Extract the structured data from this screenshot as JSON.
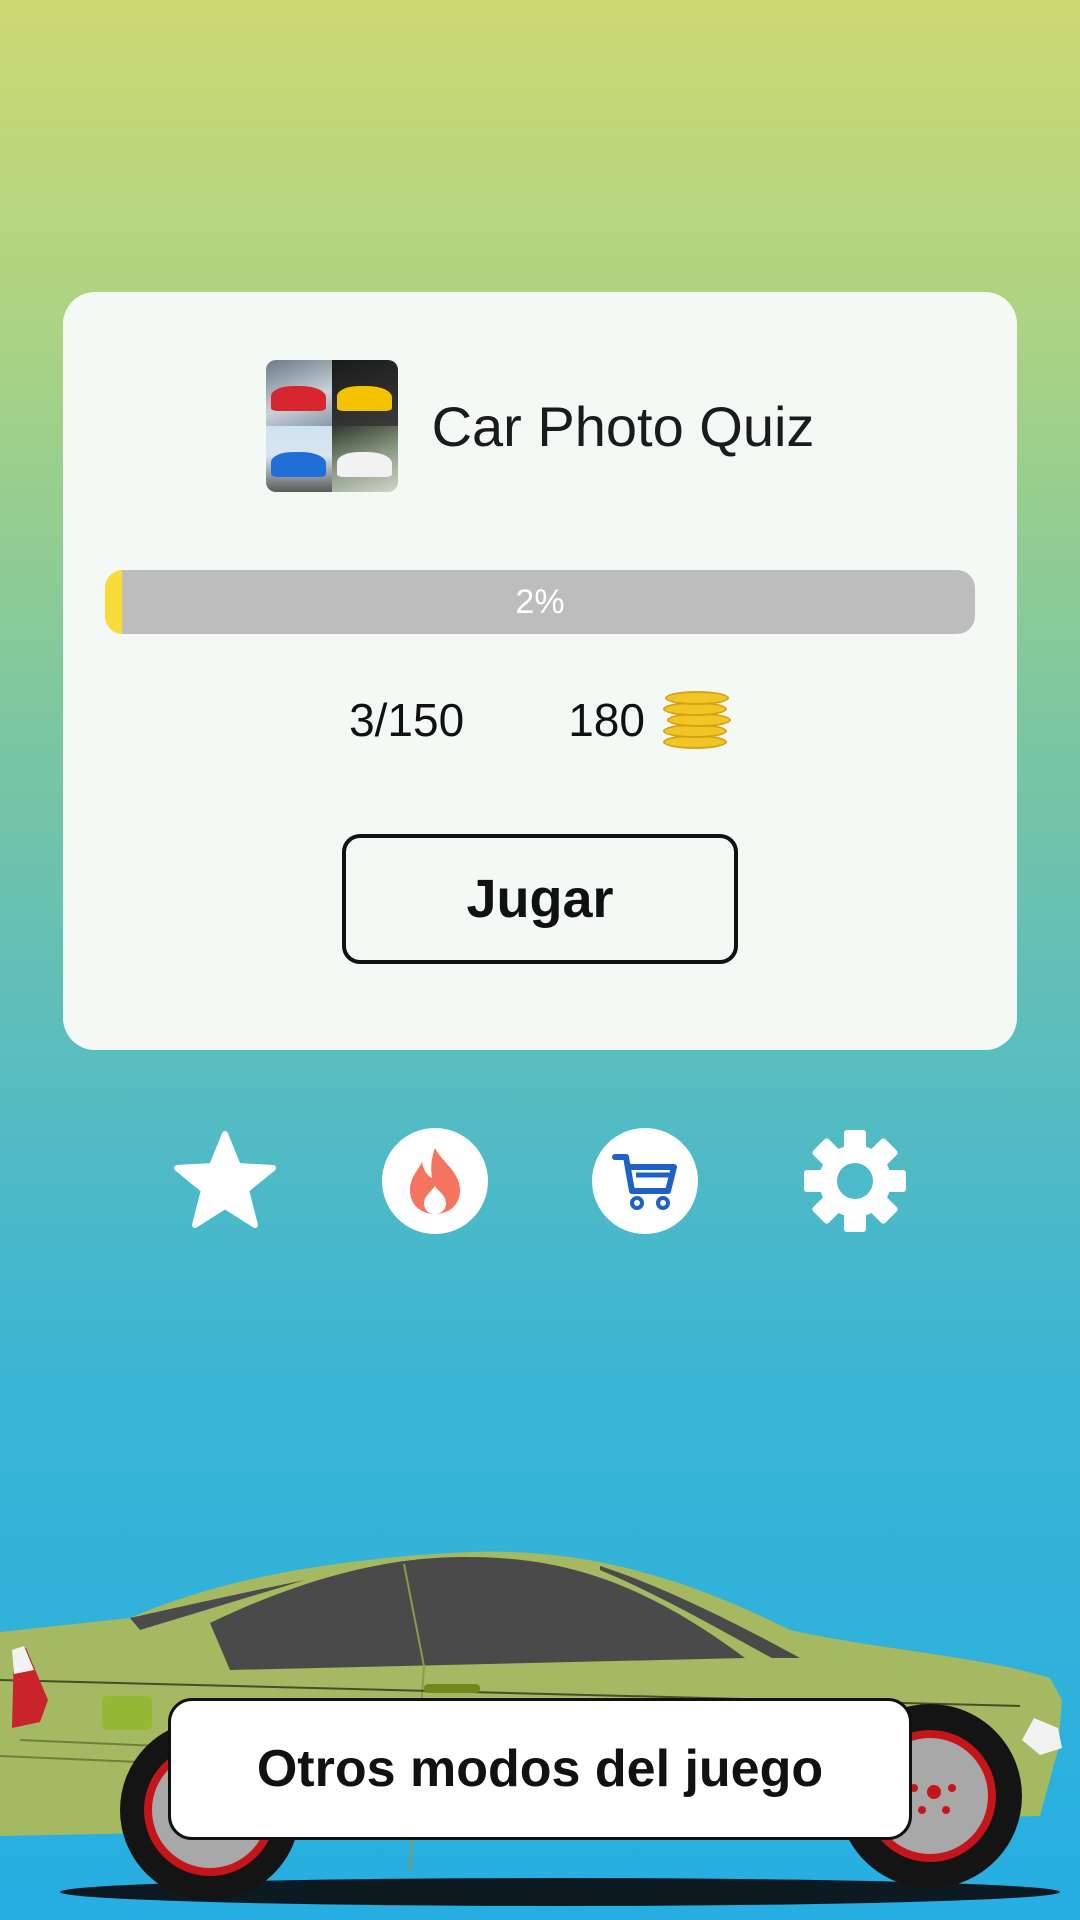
{
  "app": {
    "title": "Car Photo Quiz"
  },
  "progress": {
    "fraction": 0.02,
    "label": "2%"
  },
  "stats": {
    "solved": "3/150",
    "coins": "180"
  },
  "buttons": {
    "play": "Jugar",
    "other_modes": "Otros modos del juego"
  },
  "icons": [
    "star-icon",
    "fire-icon",
    "shopping-cart-icon",
    "gear-icon"
  ],
  "colors": {
    "progress_fill": "#f7dc3a",
    "progress_track": "#bcbdbc",
    "fire": "#f47560",
    "cart": "#1f62c7",
    "car_body": "#a5b862"
  }
}
